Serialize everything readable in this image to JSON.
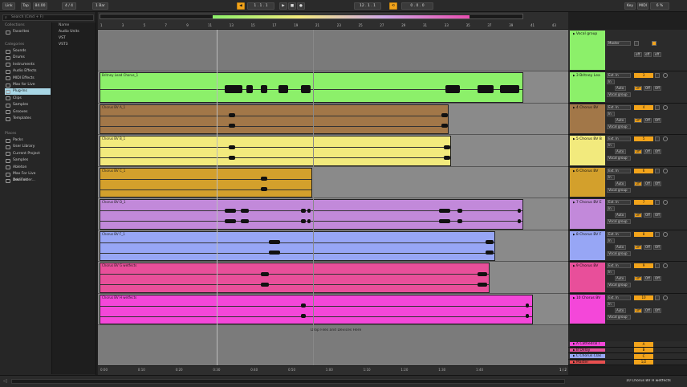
{
  "transport": {
    "link_label": "Link",
    "tap_label": "Tap",
    "tempo": "84.00",
    "signature": "4 / 4",
    "quantize": "1 Bar",
    "position": "1 . 1 . 1",
    "loop_start": "12 . 1 . 1",
    "loop_len": "0 . 0 . 0",
    "key_label": "Key",
    "midi_label": "MIDI",
    "cpu": "6 %"
  },
  "browser": {
    "search_placeholder": "Search (Cmd + F)",
    "collections_title": "Collections",
    "collections": [
      "Favorites"
    ],
    "categories_title": "Categories",
    "categories": [
      "Sounds",
      "Drums",
      "Instruments",
      "Audio Effects",
      "MIDI Effects",
      "Max for Live",
      "Plug-Ins",
      "Clips",
      "Samples",
      "Grooves",
      "Templates"
    ],
    "selected_category": "Plug-Ins",
    "places_title": "Places",
    "places": [
      "Packs",
      "User Library",
      "Current Project",
      "Samples",
      "Ableton",
      "Max For Live Devices",
      "Add Folder..."
    ],
    "column_header": "Name",
    "column_items": [
      "Audio Units",
      "VST",
      "VST3"
    ]
  },
  "ruler": {
    "bars": [
      "1",
      "3",
      "5",
      "7",
      "9",
      "11",
      "13",
      "15",
      "17",
      "19",
      "21",
      "23",
      "25",
      "27",
      "29",
      "31",
      "33",
      "35",
      "37",
      "39",
      "41",
      "43"
    ]
  },
  "timeaxis": {
    "labels": [
      "0:00",
      "0:10",
      "0:20",
      "0:30",
      "0:40",
      "0:50",
      "1:00",
      "1:10",
      "1:20",
      "1:30",
      "1:40"
    ],
    "page": "1 / 2"
  },
  "lanes": {
    "drop_hint": "Drop Files and Devices Here",
    "clips": [
      {
        "name": "Britney Lead Chorus_1",
        "color": "#8cf06a"
      },
      {
        "name": "Chorus BV A_1",
        "color": "#a27748"
      },
      {
        "name": "Chorus BV B_1",
        "color": "#f2ea7d"
      },
      {
        "name": "Chorus BV C_1",
        "color": "#d3a02c"
      },
      {
        "name": "Chorus BV D_1",
        "color": "#c289da"
      },
      {
        "name": "Chorus BV F_1",
        "color": "#97a6f5"
      },
      {
        "name": "Chorus BV G wetfects",
        "color": "#e84f9a"
      },
      {
        "name": "Chorus BV H wetfects",
        "color": "#f447d9"
      }
    ]
  },
  "tracks": {
    "group": {
      "name": "Vocal group",
      "color": "#8cf06a",
      "output": "Master",
      "num": "",
      "s": "S",
      "off1": "off",
      "off2": "off",
      "off3": "off"
    },
    "list": [
      {
        "name": "3 Britney Lea",
        "color": "#8cf06a",
        "input": "Ext. In",
        "num": "3",
        "route": "Vocal group",
        "auto": "Auto",
        "in": "In",
        "off": "Off"
      },
      {
        "name": "4 Chorus BV",
        "color": "#a27748",
        "input": "Ext. In",
        "num": "4",
        "route": "Vocal group",
        "auto": "Auto",
        "in": "In",
        "off": "Off"
      },
      {
        "name": "5 Chorus BV B",
        "color": "#f2ea7d",
        "input": "Ext. In",
        "num": "5",
        "route": "Vocal group",
        "auto": "Auto",
        "in": "In",
        "off": "Off"
      },
      {
        "name": "6 Chorus BV",
        "color": "#d3a02c",
        "input": "Ext. In",
        "num": "6",
        "route": "Vocal group",
        "auto": "Auto",
        "in": "In",
        "off": "Off"
      },
      {
        "name": "7 Chorus BV E",
        "color": "#c289da",
        "input": "Ext. In",
        "num": "7",
        "route": "Vocal group",
        "auto": "Auto",
        "in": "In",
        "off": "Off"
      },
      {
        "name": "8 Chorus BV F",
        "color": "#97a6f5",
        "input": "Ext. In",
        "num": "8",
        "route": "Vocal group",
        "auto": "Auto",
        "in": "In",
        "off": "Off"
      },
      {
        "name": "9 Chorus BV",
        "color": "#e84f9a",
        "input": "Ext. In",
        "num": "9",
        "route": "Vocal group",
        "auto": "Auto",
        "in": "In",
        "off": "Off"
      },
      {
        "name": "10 Chorus BV",
        "color": "#f447d9",
        "input": "Ext. In",
        "num": "10",
        "route": "Vocal group",
        "auto": "Auto",
        "in": "In",
        "off": "Off"
      }
    ],
    "returns": [
      {
        "name": "A Cathedral I",
        "color": "#f447d9",
        "num": "A"
      },
      {
        "name": "B Delay",
        "color": "#e84f9a",
        "num": "B"
      },
      {
        "name": "C Chorus Clas",
        "color": "#97a6f5",
        "num": "C"
      },
      {
        "name": "Master",
        "color": "#e84f4f",
        "num": "1/2"
      }
    ]
  },
  "status": {
    "selection": "10 Chorus BV H wetfects"
  }
}
